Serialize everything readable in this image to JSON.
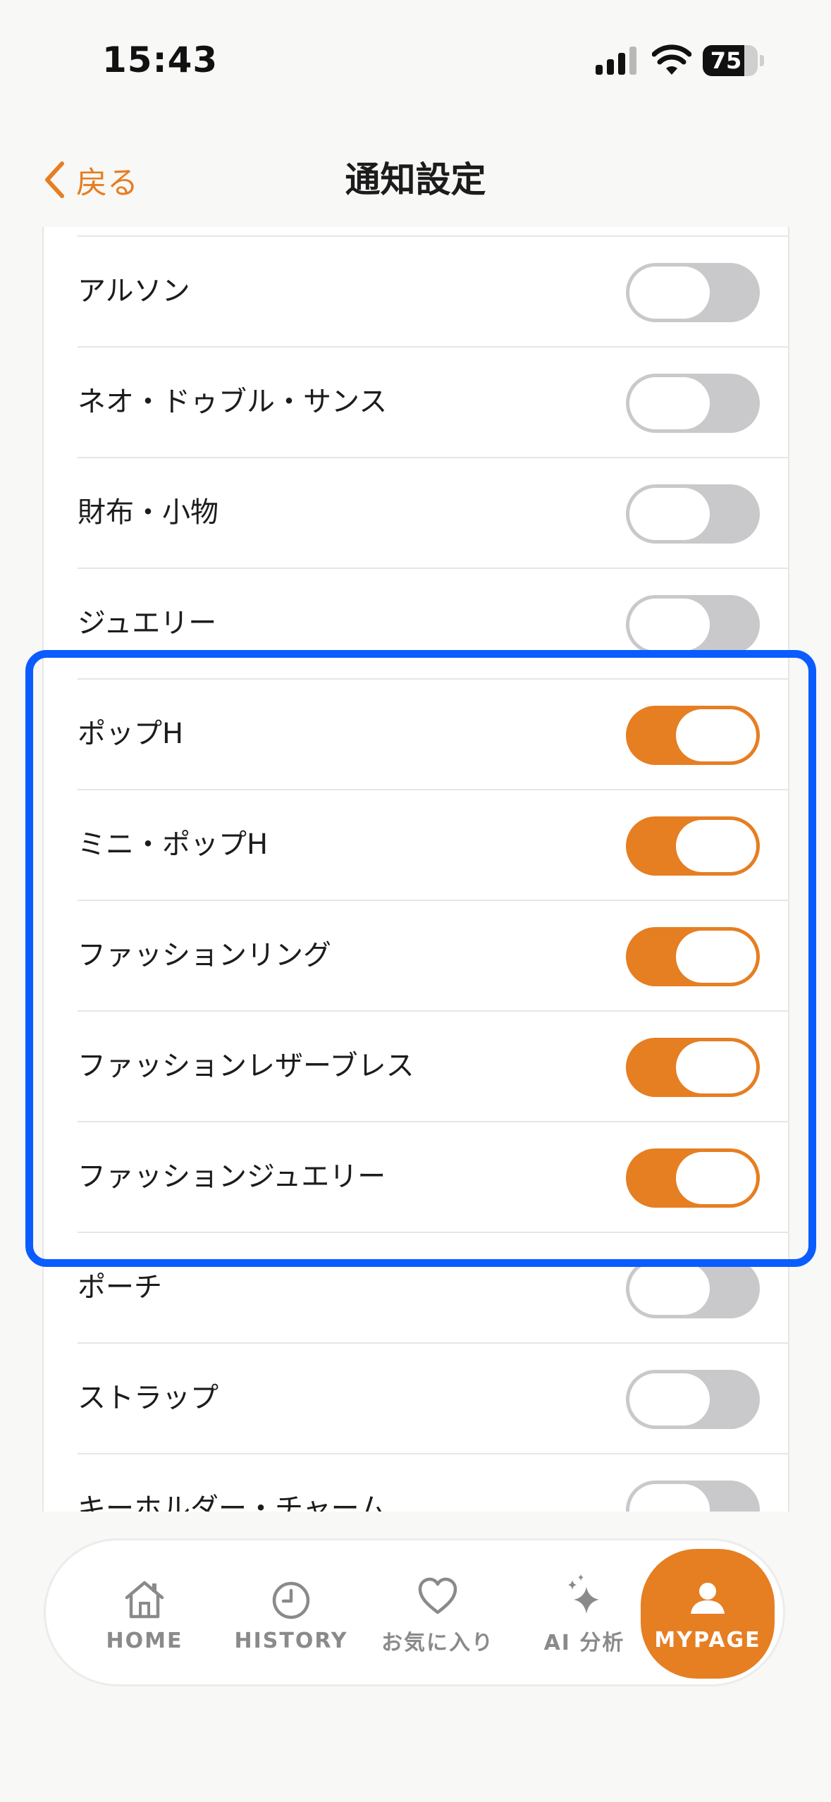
{
  "status_bar": {
    "time": "15:43",
    "battery_level": "75",
    "battery_fraction": 0.75
  },
  "header": {
    "back_label": "戻る",
    "title": "通知設定"
  },
  "settings": {
    "items": [
      {
        "label": "アルソン",
        "enabled": false
      },
      {
        "label": "ネオ・ドゥブル・サンス",
        "enabled": false
      },
      {
        "label": "財布・小物",
        "enabled": false
      },
      {
        "label": "ジュエリー",
        "enabled": false
      },
      {
        "label": "ポップH",
        "enabled": true
      },
      {
        "label": "ミニ・ポップH",
        "enabled": true
      },
      {
        "label": "ファッションリング",
        "enabled": true
      },
      {
        "label": "ファッションレザーブレス",
        "enabled": true
      },
      {
        "label": "ファッションジュエリー",
        "enabled": true
      },
      {
        "label": "ポーチ",
        "enabled": false
      },
      {
        "label": "ストラップ",
        "enabled": false
      },
      {
        "label": "キーホルダー・チャーム",
        "enabled": false
      }
    ]
  },
  "tab_bar": {
    "items": [
      {
        "label": "HOME",
        "icon": "home-icon",
        "active": false
      },
      {
        "label": "HISTORY",
        "icon": "clock-icon",
        "active": false
      },
      {
        "label": "お気に入り",
        "icon": "heart-icon",
        "active": false
      },
      {
        "label": "AI 分析",
        "icon": "sparkle-icon",
        "active": false
      },
      {
        "label": "MYPAGE",
        "icon": "user-icon",
        "active": true
      }
    ]
  },
  "colors": {
    "accent": "#e67e22",
    "highlight": "#0a5cff",
    "toggle_off": "#c9c9cb"
  }
}
